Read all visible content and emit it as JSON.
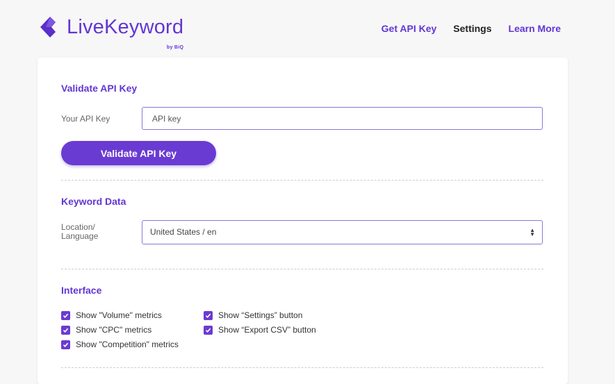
{
  "brand": {
    "name": "LiveKeyword",
    "by": "by BiQ",
    "color": "#6236d3"
  },
  "nav": [
    {
      "label": "Get API Key",
      "active": false
    },
    {
      "label": "Settings",
      "active": true
    },
    {
      "label": "Learn More",
      "active": false
    }
  ],
  "api": {
    "title": "Validate API Key",
    "label": "Your API Key",
    "placeholder": "API key",
    "value": "",
    "button": "Validate API Key"
  },
  "keyword_data": {
    "title": "Keyword Data",
    "label_line1": "Location/",
    "label_line2": "Language",
    "selected": "United States / en"
  },
  "interface": {
    "title": "Interface",
    "options": [
      {
        "label": "Show \"Volume\" metrics",
        "checked": true
      },
      {
        "label": "Show \"CPC\" metrics",
        "checked": true
      },
      {
        "label": "Show \"Competition\" metrics",
        "checked": true
      },
      {
        "label": "Show “Settings” button",
        "checked": true
      },
      {
        "label": "Show “Export CSV” button",
        "checked": true
      }
    ]
  }
}
